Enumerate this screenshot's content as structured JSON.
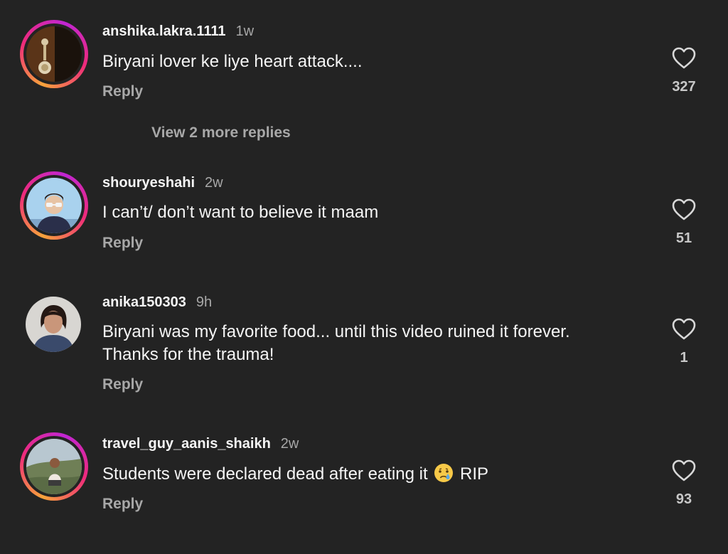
{
  "comments": [
    {
      "username": "anshika.lakra.1111",
      "time": "1w",
      "text": "Biryani lover ke liye heart attack....",
      "reply_label": "Reply",
      "likes": "327",
      "view_replies_label": "View 2 more replies"
    },
    {
      "username": "shouryeshahi",
      "time": "2w",
      "text": "I can’t/ don’t want to believe it maam",
      "reply_label": "Reply",
      "likes": "51"
    },
    {
      "username": "anika150303",
      "time": "9h",
      "text_line1": "Biryani was my favorite food... until this video ruined it forever.",
      "text_line2": "Thanks for the trauma!",
      "reply_label": "Reply",
      "likes": "1"
    },
    {
      "username": "travel_guy_aanis_shaikh",
      "time": "2w",
      "text_before_emoji": "Students were declared dead after eating it",
      "emoji": "😢",
      "text_after_emoji": "RIP",
      "reply_label": "Reply",
      "likes": "93"
    }
  ],
  "icons": {
    "like": "heart-outline-icon",
    "emoji": "crying-face-emoji"
  },
  "colors": {
    "background": "#232323",
    "primary_text": "#f5f5f5",
    "secondary_text": "#a8a8a8",
    "story_ring_start": "#f7a33b",
    "story_ring_end": "#c026d3"
  }
}
